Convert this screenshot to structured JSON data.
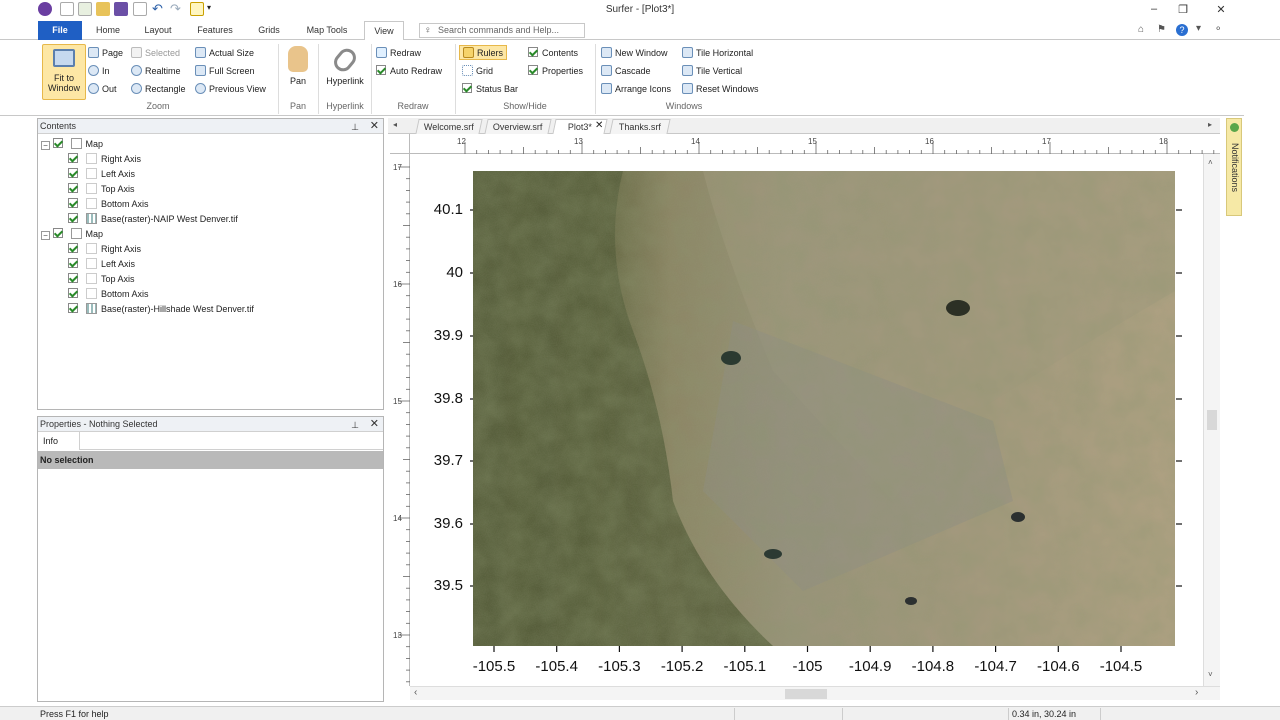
{
  "window": {
    "title": "Surfer - [Plot3*]"
  },
  "tabs": [
    "File",
    "Home",
    "Layout",
    "Features",
    "Grids",
    "Map Tools",
    "View"
  ],
  "search": {
    "placeholder": "Search commands and Help..."
  },
  "ribbon": {
    "zoom": {
      "fit_window": "Fit to Window",
      "page": "Page",
      "selected": "Selected",
      "actual_size": "Actual Size",
      "in": "In",
      "realtime": "Realtime",
      "full_screen": "Full Screen",
      "out": "Out",
      "rectangle": "Rectangle",
      "previous_view": "Previous View",
      "label": "Zoom"
    },
    "pan": {
      "button": "Pan",
      "label": "Pan"
    },
    "hyperlink": {
      "button": "Hyperlink",
      "label": "Hyperlink"
    },
    "redraw": {
      "redraw": "Redraw",
      "auto_redraw": "Auto Redraw",
      "label": "Redraw"
    },
    "show_hide": {
      "rulers": "Rulers",
      "grid": "Grid",
      "status_bar": "Status Bar",
      "contents": "Contents",
      "properties": "Properties",
      "label": "Show/Hide"
    },
    "windows": {
      "new_window": "New Window",
      "cascade": "Cascade",
      "arrange_icons": "Arrange Icons",
      "tile_horizontal": "Tile Horizontal",
      "tile_vertical": "Tile Vertical",
      "reset_windows": "Reset Windows",
      "label": "Windows"
    }
  },
  "contents": {
    "title": "Contents",
    "maps": [
      {
        "label": "Map",
        "children": [
          "Right Axis",
          "Left Axis",
          "Top Axis",
          "Bottom Axis",
          "Base(raster)-NAIP West Denver.tif"
        ]
      },
      {
        "label": "Map",
        "children": [
          "Right Axis",
          "Left Axis",
          "Top Axis",
          "Bottom Axis",
          "Base(raster)-Hillshade West Denver.tif"
        ]
      }
    ]
  },
  "properties": {
    "title": "Properties - Nothing Selected",
    "tab": "Info",
    "status": "No selection"
  },
  "doc_tabs": [
    "Welcome.srf",
    "Overview.srf",
    "Plot3*",
    "Thanks.srf"
  ],
  "ruler": {
    "h_labels": [
      "12",
      "13",
      "14",
      "15",
      "16",
      "17",
      "18"
    ],
    "v_labels": [
      "17",
      "16",
      "15",
      "14",
      "13"
    ]
  },
  "map": {
    "y_ticks": [
      "40.1",
      "40",
      "39.9",
      "39.8",
      "39.7",
      "39.6",
      "39.5"
    ],
    "x_ticks": [
      "-105.5",
      "-105.4",
      "-105.3",
      "-105.2",
      "-105.1",
      "-105",
      "-104.9",
      "-104.8",
      "-104.7",
      "-104.6",
      "-104.5"
    ]
  },
  "notifications": {
    "label": "Notifications"
  },
  "status": {
    "help": "Press F1 for help",
    "coords": "0.34 in, 30.24 in"
  }
}
